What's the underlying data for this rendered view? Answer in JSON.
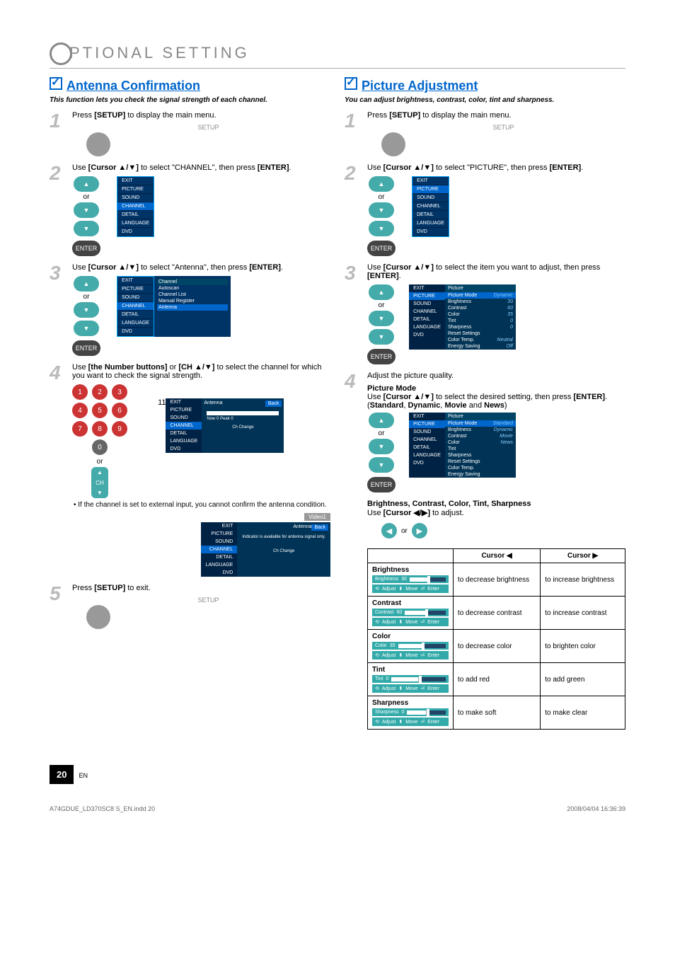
{
  "header": {
    "title": "PTIONAL  SETTING"
  },
  "left": {
    "title": "Antenna Confirmation",
    "sub": "This function lets you check the signal strength of each channel.",
    "s1": "Press [SETUP] to display the main menu.",
    "s1lbl": "SETUP",
    "s2": "Use [Cursor ▲/▼] to select \"CHANNEL\", then press [ENTER].",
    "or": "or",
    "enter": "ENTER",
    "menu": [
      "EXIT",
      "PICTURE",
      "SOUND",
      "CHANNEL",
      "DETAIL",
      "LANGUAGE",
      "DVD"
    ],
    "s3": "Use [Cursor ▲/▼] to select \"Antenna\", then press [ENTER].",
    "chmenu": {
      "title": "Channel",
      "items": [
        "Autoscan",
        "Channel List",
        "Manual Register",
        "Antenna"
      ]
    },
    "s4": "Use [the Number buttons] or [CH ▲/▼] to select the channel for which you want to check the signal strength.",
    "ant": {
      "title": "Antenna",
      "back": "Back",
      "peak": "Now       0  Peak      0",
      "ch": "Ch Change",
      "num": "11"
    },
    "note": "If the channel is set to external input, you cannot confirm the antenna condition.",
    "vid": "Video1",
    "ant2": {
      "title": "Antenna",
      "back": "Back",
      "msg": "Indicator is available for antenna signal only.",
      "ch": "Ch Change"
    },
    "s5": "Press [SETUP] to exit."
  },
  "right": {
    "title": "Picture Adjustment",
    "sub": "You can adjust brightness, contrast, color, tint and sharpness.",
    "s1": "Press [SETUP] to display the main menu.",
    "s2": "Use [Cursor ▲/▼] to select \"PICTURE\", then press [ENTER].",
    "s3": "Use [Cursor ▲/▼] to select the item you want to adjust, then press [ENTER].",
    "picmenu": {
      "title": "Picture",
      "items": [
        [
          "Picture Mode",
          "Dynamic"
        ],
        [
          "Brightness",
          "30"
        ],
        [
          "Contrast",
          "60"
        ],
        [
          "Color",
          "35"
        ],
        [
          "Tint",
          "0"
        ],
        [
          "Sharpness",
          "0"
        ],
        [
          "Reset Settings",
          ""
        ],
        [
          "Color Temp.",
          "Neutral"
        ],
        [
          "Energy Saving",
          "Off"
        ]
      ]
    },
    "s4": "Adjust the picture quality.",
    "pm": {
      "title": "Picture Mode",
      "txt": "Use [Cursor ▲/▼] to select the desired setting, then press [ENTER]. (Standard, Dynamic, Movie and News)"
    },
    "pmmenu": {
      "items": [
        [
          "Picture Mode",
          "Standard"
        ],
        [
          "Brightness",
          "Dynamic"
        ],
        [
          "Contrast",
          "Movie"
        ],
        [
          "Color",
          "News"
        ],
        [
          "Tint",
          ""
        ],
        [
          "Sharpness",
          ""
        ],
        [
          "Reset Settings",
          ""
        ],
        [
          "Color Temp.",
          ""
        ],
        [
          "Energy Saving",
          ""
        ]
      ]
    },
    "bcct": {
      "title": "Brightness, Contrast, Color, Tint, Sharpness",
      "txt": "Use [Cursor ◀/▶] to adjust."
    },
    "th": [
      "",
      "Cursor ◀",
      "Cursor ▶"
    ],
    "rows": [
      {
        "name": "Brightness",
        "lbl": "Brightness",
        "val": "30",
        "l": "to decrease brightness",
        "r": "to increase brightness"
      },
      {
        "name": "Contrast",
        "lbl": "Contrast",
        "val": "60",
        "l": "to decrease contrast",
        "r": "to increase contrast"
      },
      {
        "name": "Color",
        "lbl": "Color",
        "val": "35",
        "l": "to decrease color",
        "r": "to brighten color"
      },
      {
        "name": "Tint",
        "lbl": "Tint",
        "val": "0",
        "l": "to add red",
        "r": "to add green"
      },
      {
        "name": "Sharpness",
        "lbl": "Sharpness",
        "val": "0",
        "l": "to make soft",
        "r": "to make clear"
      }
    ],
    "sliderft": [
      "Adjust",
      "Move",
      "Enter"
    ]
  },
  "pg": "20",
  "en": "EN",
  "footsrc": "A74GDUE_LD370SC8 S_EN.indd   20",
  "footdate": "2008/04/04   16:36:39"
}
